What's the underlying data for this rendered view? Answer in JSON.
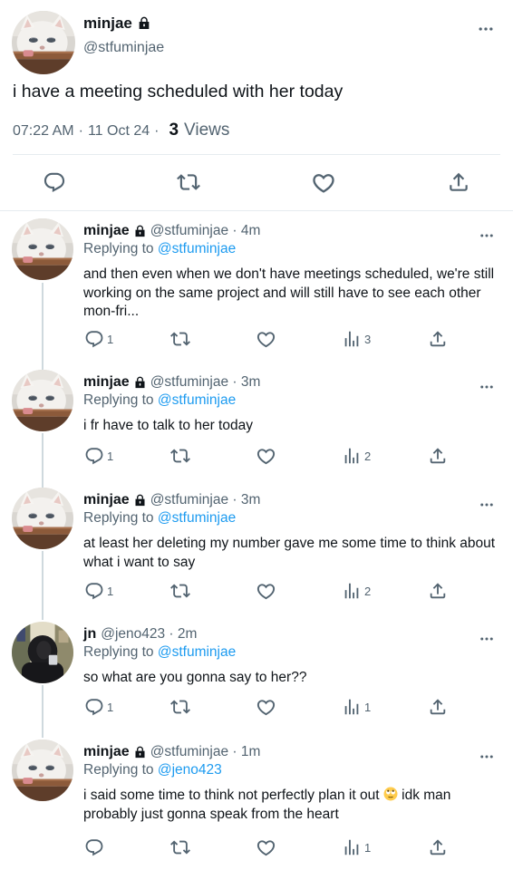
{
  "main_tweet": {
    "author_name": "minjae",
    "author_handle": "@stfuminjae",
    "text": "i have a meeting scheduled with her today",
    "time": "07:22 AM",
    "date": "11 Oct 24",
    "views_count": "3",
    "views_label": "Views"
  },
  "replies": [
    {
      "name": "minjae",
      "locked": true,
      "handle_time": "@stfuminjae · 4m",
      "replying_prefix": "Replying to",
      "replying_to": "@stfuminjae",
      "text": "and then even when we don't have meetings scheduled, we're still working on the same project and will still have to see each other mon-fri...",
      "reply_count": "1",
      "view_count": "3"
    },
    {
      "name": "minjae",
      "locked": true,
      "handle_time": "@stfuminjae · 3m",
      "replying_prefix": "Replying to",
      "replying_to": "@stfuminjae",
      "text": "i fr have to talk to her today",
      "reply_count": "1",
      "view_count": "2"
    },
    {
      "name": "minjae",
      "locked": true,
      "handle_time": "@stfuminjae · 3m",
      "replying_prefix": "Replying to",
      "replying_to": "@stfuminjae",
      "text": "at least her deleting my number gave me some time to think about what i want to say",
      "reply_count": "1",
      "view_count": "2"
    },
    {
      "name": "jn",
      "locked": false,
      "handle_time": "@jeno423 · 2m",
      "replying_prefix": "Replying to",
      "replying_to": "@stfuminjae",
      "text": "so what are you gonna say to her??",
      "reply_count": "1",
      "view_count": "1"
    },
    {
      "name": "minjae",
      "locked": true,
      "handle_time": "@stfuminjae · 1m",
      "replying_prefix": "Replying to",
      "replying_to": "@jeno423",
      "text_before_emoji": "i said some time to think not perfectly plan it out ",
      "text_after_emoji": " idk man probably just gonna speak from the heart",
      "emoji": "rolling-eyes-emoji",
      "view_count": "1"
    }
  ],
  "icons": {
    "reply": "reply-icon",
    "retweet": "retweet-icon",
    "like": "heart-icon",
    "views": "views-icon",
    "share": "share-icon",
    "more": "more-icon",
    "lock": "lock-icon"
  },
  "colors": {
    "text": "#0f1419",
    "secondary": "#536471",
    "link": "#1d9bf0",
    "divider": "#e6ecf0"
  }
}
